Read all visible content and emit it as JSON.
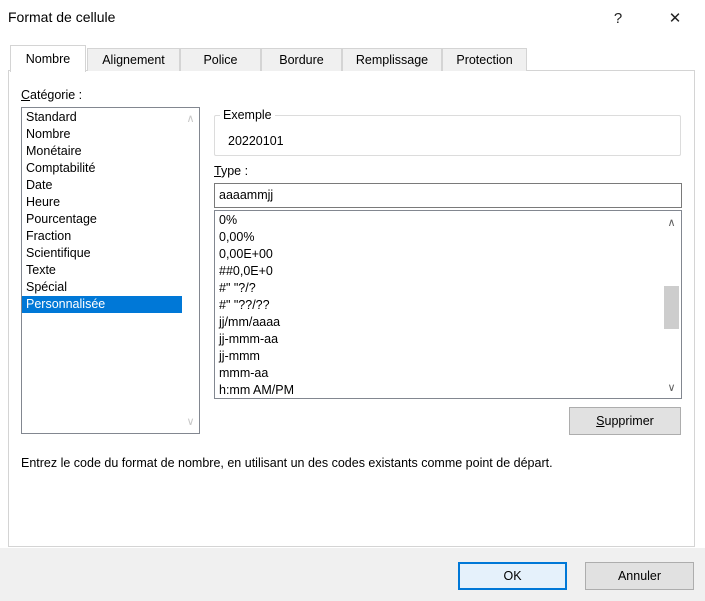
{
  "window": {
    "title": "Format de cellule",
    "help_glyph": "?",
    "close_glyph": "✕"
  },
  "tabs": [
    {
      "label": "Nombre",
      "active": true
    },
    {
      "label": "Alignement"
    },
    {
      "label": "Police"
    },
    {
      "label": "Bordure"
    },
    {
      "label": "Remplissage"
    },
    {
      "label": "Protection"
    }
  ],
  "category": {
    "label": "Catégorie :",
    "items": [
      "Standard",
      "Nombre",
      "Monétaire",
      "Comptabilité",
      "Date",
      "Heure",
      "Pourcentage",
      "Fraction",
      "Scientifique",
      "Texte",
      "Spécial",
      "Personnalisée"
    ],
    "selected": "Personnalisée"
  },
  "example": {
    "label": "Exemple",
    "value": "20220101"
  },
  "type": {
    "label": "Type :",
    "value": "aaaammjj",
    "list": [
      "0%",
      "0,00%",
      "0,00E+00",
      "##0,0E+0",
      "#\" \"?/?",
      "#\" \"??/??",
      "jj/mm/aaaa",
      "jj-mmm-aa",
      "jj-mmm",
      "mmm-aa",
      "h:mm AM/PM"
    ]
  },
  "buttons": {
    "delete": "Supprimer",
    "ok": "OK",
    "cancel": "Annuler"
  },
  "description": "Entrez le code du format de nombre, en utilisant un des codes existants comme point de départ."
}
